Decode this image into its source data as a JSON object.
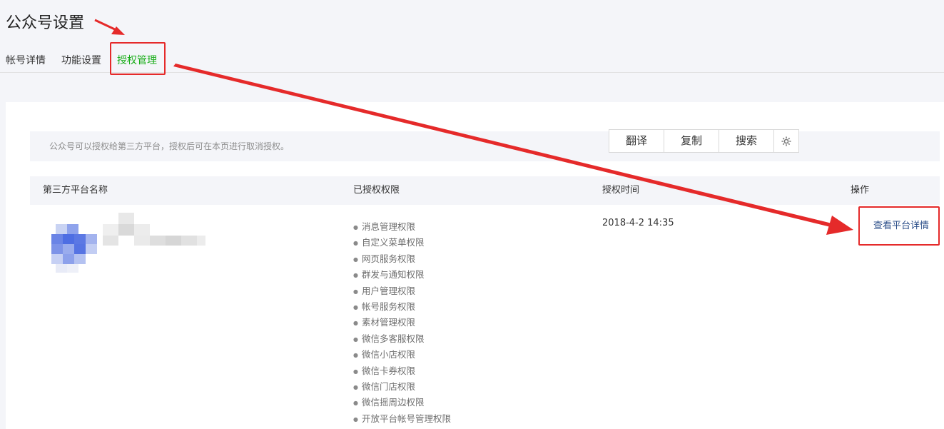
{
  "header": {
    "title": "公众号设置"
  },
  "tabs": [
    {
      "label": "帐号详情"
    },
    {
      "label": "功能设置"
    },
    {
      "label": "授权管理"
    }
  ],
  "tip": "公众号可以授权给第三方平台，授权后可在本页进行取消授权。",
  "toolbar": {
    "translate": "翻译",
    "copy": "复制",
    "search": "搜索",
    "settings_icon": "gear-icon"
  },
  "table": {
    "headers": [
      "第三方平台名称",
      "已授权权限",
      "授权时间",
      "操作"
    ],
    "row": {
      "time": "2018-4-2 14:35",
      "action": "查看平台详情",
      "permissions": [
        "消息管理权限",
        "自定义菜单权限",
        "网页服务权限",
        "群发与通知权限",
        "用户管理权限",
        "帐号服务权限",
        "素材管理权限",
        "微信多客服权限",
        "微信小店权限",
        "微信卡券权限",
        "微信门店权限",
        "微信摇周边权限",
        "开放平台帐号管理权限"
      ]
    }
  },
  "colors": {
    "accent": "#1aad19",
    "link": "#2a4d88",
    "annotation": "#e52a2a"
  }
}
